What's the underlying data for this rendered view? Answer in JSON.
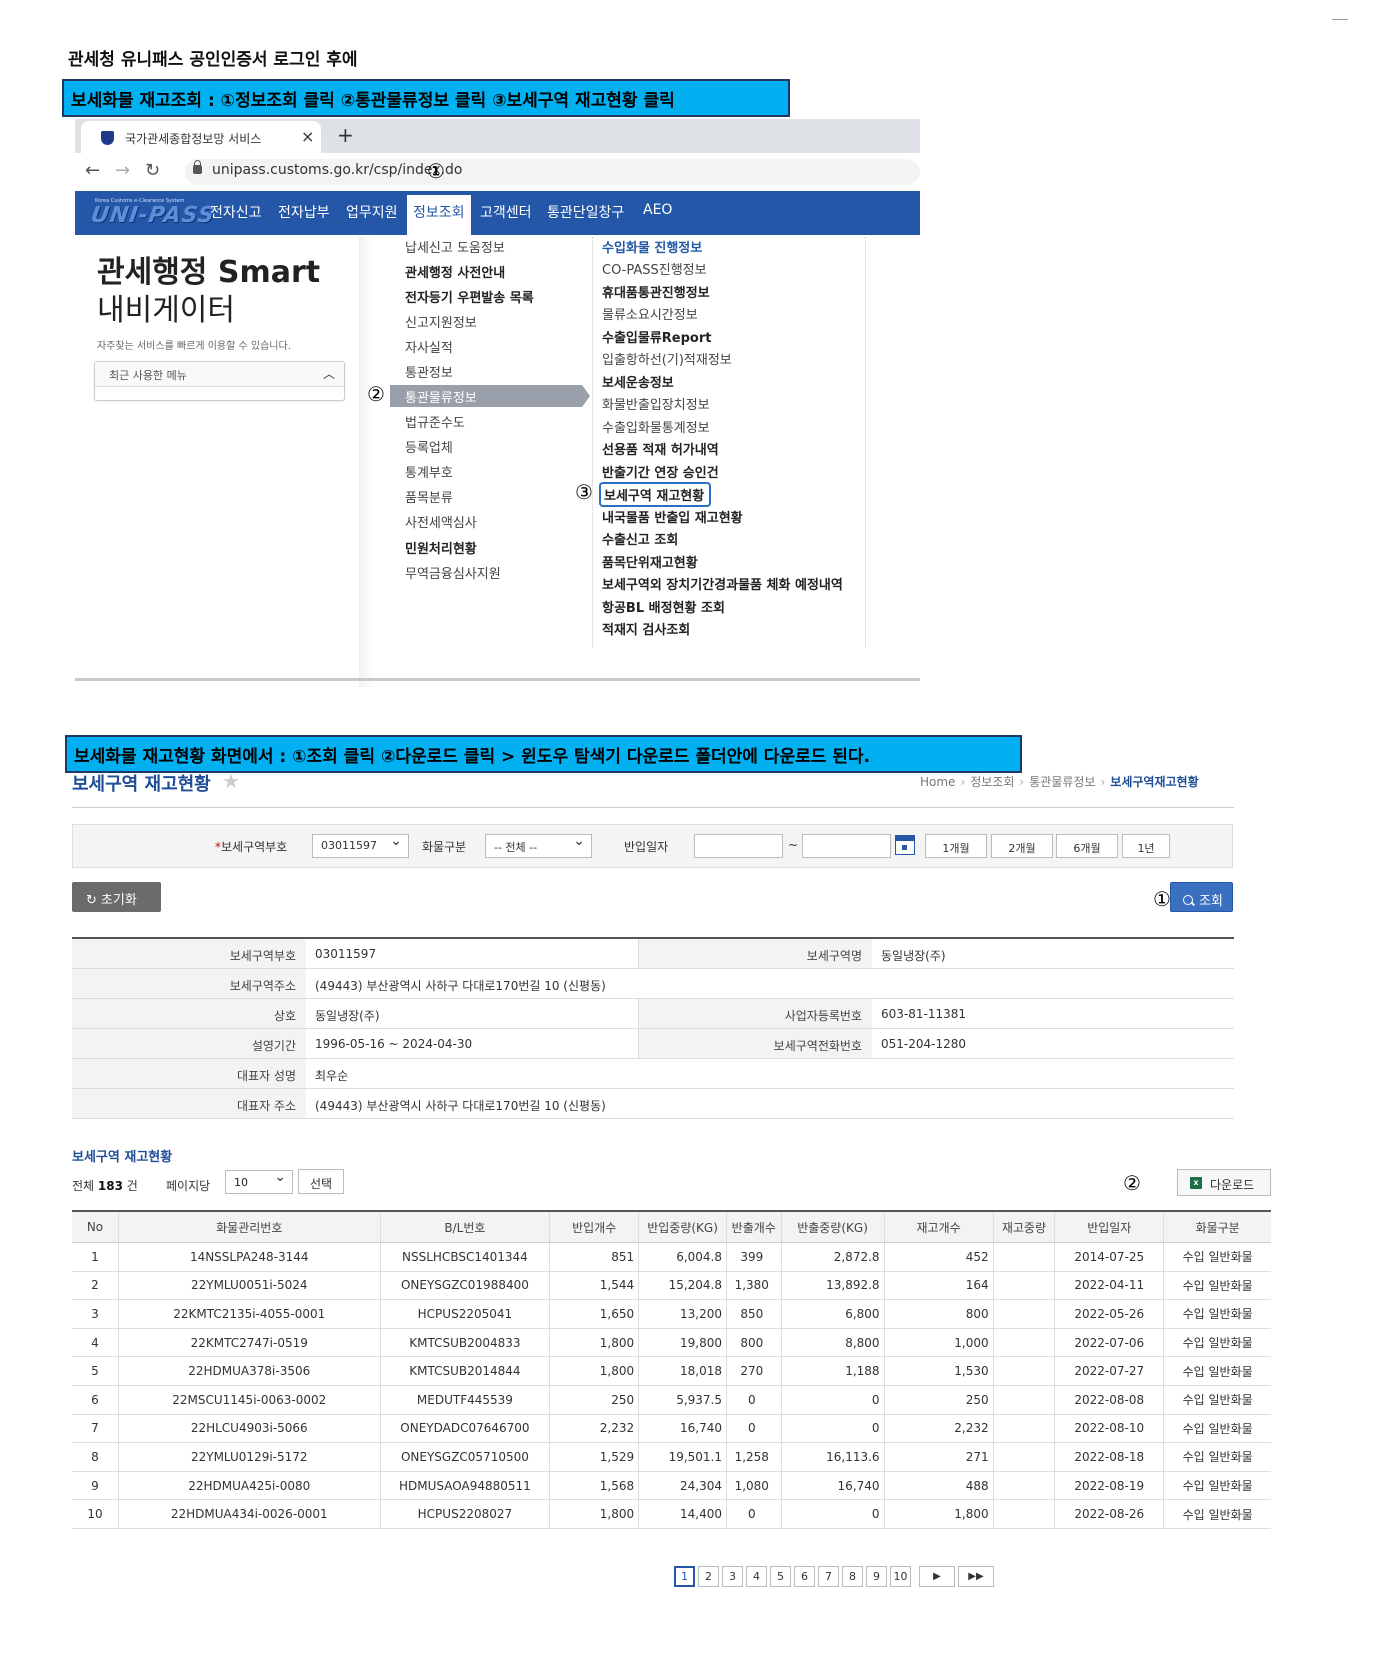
{
  "doc": {
    "title": "관세청 유니패스 공인인증서 로그인 후에",
    "banner1": "보세화물 재고조회 : ①정보조회 클릭  ②통관물류정보 클릭 ③보세구역 재고현황 클릭",
    "banner2": "보세화물 재고현황 화면에서 : ①조회 클릭  ②다운로드 클릭 > 윈도우 탐색기 다운로드 폴더안에 다운로드 된다."
  },
  "marks": {
    "m1": "①",
    "m2": "②",
    "m3": "③"
  },
  "browser": {
    "tab_title": "국가관세종합정보망 서비스",
    "tab_close": "×",
    "new_tab": "+",
    "back": "←",
    "forward": "→",
    "reload": "↻",
    "url": "unipass.customs.go.kr/csp/index.do"
  },
  "site": {
    "logo_small": "Korea Customs e-Clearance System",
    "logo": "UNI-PASS",
    "gnb": [
      "전자신고",
      "전자납부",
      "업무지원",
      "정보조회",
      "고객센터",
      "통관단일창구",
      "AEO"
    ],
    "active_gnb_index": 3,
    "smart_title": "관세행정 Smart",
    "smart_sub": "내비게이터",
    "smart_desc": "자주찾는 서비스를 빠르게 이용할 수 있습니다.",
    "recent_menu": "최근 사용한 메뉴",
    "left_menu": [
      {
        "label": "납세신고 도움정보",
        "bold": false
      },
      {
        "label": "관세행정 사전안내",
        "bold": true
      },
      {
        "label": "전자등기 우편발송 목록",
        "bold": true
      },
      {
        "label": "신고지원정보",
        "bold": false
      },
      {
        "label": "자사실적",
        "bold": false
      },
      {
        "label": "통관정보",
        "bold": false
      },
      {
        "label": "통관물류정보",
        "bold": false,
        "active": true
      },
      {
        "label": "법규준수도",
        "bold": false
      },
      {
        "label": "등록업체",
        "bold": false
      },
      {
        "label": "통계부호",
        "bold": false
      },
      {
        "label": "품목분류",
        "bold": false
      },
      {
        "label": "사전세액심사",
        "bold": false
      },
      {
        "label": "민원처리현황",
        "bold": true
      },
      {
        "label": "무역금융심사지원",
        "bold": false
      }
    ],
    "right_menu": [
      {
        "label": "수입화물 진행정보",
        "style": "blue"
      },
      {
        "label": "CO-PASS진행정보",
        "style": ""
      },
      {
        "label": "휴대품통관진행정보",
        "style": "bold"
      },
      {
        "label": "물류소요시간정보",
        "style": ""
      },
      {
        "label": "수출입물류Report",
        "style": "bold"
      },
      {
        "label": "입출항하선(기)적재정보",
        "style": ""
      },
      {
        "label": "보세운송정보",
        "style": "bold"
      },
      {
        "label": "화물반출입장치정보",
        "style": ""
      },
      {
        "label": "수출입화물통계정보",
        "style": ""
      },
      {
        "label": "선용품 적재 허가내역",
        "style": "bold"
      },
      {
        "label": "반출기간 연장 승인건",
        "style": "bold"
      },
      {
        "label": "보세구역 재고현황",
        "style": "boxed"
      },
      {
        "label": "내국물품 반출입 재고현황",
        "style": "bold"
      },
      {
        "label": "수출신고 조회",
        "style": "bold"
      },
      {
        "label": "품목단위재고현황",
        "style": "bold"
      },
      {
        "label": "보세구역외 장치기간경과물품 체화 예정내역",
        "style": "bold"
      },
      {
        "label": "항공BL 배정현황 조회",
        "style": "bold"
      },
      {
        "label": "적재지 검사조회",
        "style": "bold"
      }
    ]
  },
  "screen": {
    "title": "보세구역 재고현황",
    "star": "★",
    "breadcrumb": [
      "Home",
      "정보조회",
      "통관물류정보",
      "보세구역재고현황"
    ],
    "breadcrumb_sep": "›",
    "search": {
      "req_mark": "*",
      "area_label": "보세구역부호",
      "area_value": "03011597",
      "cargo_label": "화물구분",
      "cargo_value": "-- 전체 --",
      "date_label": "반입일자",
      "tilde": "~",
      "periods": [
        "1개월",
        "2개월",
        "6개월",
        "1년"
      ]
    },
    "reset_label": "초기화",
    "reset_icon": "↻",
    "search_label": "조회",
    "info": {
      "area_code_label": "보세구역부호",
      "area_code": "03011597",
      "area_name_label": "보세구역명",
      "area_name": "동일냉장(주)",
      "address_label": "보세구역주소",
      "address": "(49443) 부산광역시 사하구 다대로170번길 10 (신평동)",
      "company_label": "상호",
      "company": "동일냉장(주)",
      "biz_no_label": "사업자등록번호",
      "biz_no": "603-81-11381",
      "period_label": "설영기간",
      "period": "1996-05-16 ~ 2024-04-30",
      "phone_label": "보세구역전화번호",
      "phone": "051-204-1280",
      "rep_label": "대표자 성명",
      "rep": "최우순",
      "rep_addr_label": "대표자 주소",
      "rep_addr": "(49443) 부산광역시 사하구 다대로170번길 10 (신평동)"
    },
    "section_title": "보세구역 재고현황",
    "total_prefix": "전체 ",
    "total_count": "183",
    "total_suffix": " 건",
    "perpage_label": "페이지당",
    "perpage_value": "10",
    "choose_label": "선택",
    "download_label": "다운로드",
    "xls_icon": "x",
    "columns": [
      "No",
      "화물관리번호",
      "B/L번호",
      "반입개수",
      "반입중량(KG)",
      "반출개수",
      "반출중량(KG)",
      "재고개수",
      "재고중량",
      "반입일자",
      "화물구분"
    ],
    "rows": [
      [
        "1",
        "14NSSLPA248-3144",
        "NSSLHCBSC1401344",
        "851",
        "6,004.8",
        "399",
        "2,872.8",
        "452",
        "",
        "2014-07-25",
        "수입 일반화물"
      ],
      [
        "2",
        "22YMLU0051i-5024",
        "ONEYSGZC01988400",
        "1,544",
        "15,204.8",
        "1,380",
        "13,892.8",
        "164",
        "",
        "2022-04-11",
        "수입 일반화물"
      ],
      [
        "3",
        "22KMTC2135i-4055-0001",
        "HCPUS2205041",
        "1,650",
        "13,200",
        "850",
        "6,800",
        "800",
        "",
        "2022-05-26",
        "수입 일반화물"
      ],
      [
        "4",
        "22KMTC2747i-0519",
        "KMTCSUB2004833",
        "1,800",
        "19,800",
        "800",
        "8,800",
        "1,000",
        "",
        "2022-07-06",
        "수입 일반화물"
      ],
      [
        "5",
        "22HDMUA378i-3506",
        "KMTCSUB2014844",
        "1,800",
        "18,018",
        "270",
        "1,188",
        "1,530",
        "",
        "2022-07-27",
        "수입 일반화물"
      ],
      [
        "6",
        "22MSCU1145i-0063-0002",
        "MEDUTF445539",
        "250",
        "5,937.5",
        "0",
        "0",
        "250",
        "",
        "2022-08-08",
        "수입 일반화물"
      ],
      [
        "7",
        "22HLCU4903i-5066",
        "ONEYDADC07646700",
        "2,232",
        "16,740",
        "0",
        "0",
        "2,232",
        "",
        "2022-08-10",
        "수입 일반화물"
      ],
      [
        "8",
        "22YMLU0129i-5172",
        "ONEYSGZC05710500",
        "1,529",
        "19,501.1",
        "1,258",
        "16,113.6",
        "271",
        "",
        "2022-08-18",
        "수입 일반화물"
      ],
      [
        "9",
        "22HDMUA425i-0080",
        "HDMUSAOA94880511",
        "1,568",
        "24,304",
        "1,080",
        "16,740",
        "488",
        "",
        "2022-08-19",
        "수입 일반화물"
      ],
      [
        "10",
        "22HDMUA434i-0026-0001",
        "HCPUS2208027",
        "1,800",
        "14,400",
        "0",
        "0",
        "1,800",
        "",
        "2022-08-26",
        "수입 일반화물"
      ]
    ],
    "pages": [
      "1",
      "2",
      "3",
      "4",
      "5",
      "6",
      "7",
      "8",
      "9",
      "10"
    ],
    "current_page": "1",
    "next": "▶",
    "last": "▶▶"
  },
  "colors": {
    "banner": "#00b0f0",
    "gnb": "#2457a8",
    "link_blue": "#1f4e96"
  }
}
